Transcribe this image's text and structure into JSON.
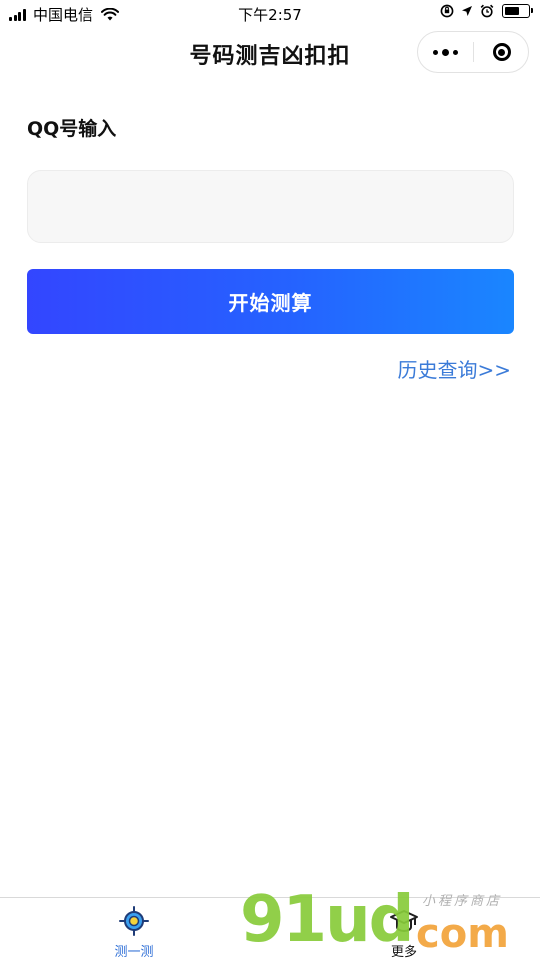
{
  "status_bar": {
    "carrier": "中国电信",
    "time": "下午2:57",
    "icons": [
      "signal-icon",
      "wifi-icon",
      "orientation-lock-icon",
      "location-icon",
      "alarm-icon",
      "battery-icon"
    ]
  },
  "nav": {
    "title": "号码测吉凶扣扣",
    "capsule_icons": [
      "more-dots-icon",
      "close-target-icon"
    ]
  },
  "form": {
    "label": "QQ号输入",
    "input_value": "",
    "button_label": "开始测算",
    "history_link": "历史查询>>"
  },
  "colors": {
    "button_gradient_start": "#3346ff",
    "button_gradient_end": "#1a86ff",
    "link": "#3b7bd8",
    "tab_active": "#2f6fd6"
  },
  "tabbar": {
    "items": [
      {
        "label": "测一测",
        "icon": "target-icon",
        "active": true
      },
      {
        "label": "更多",
        "icon": "graduation-cap-icon",
        "active": false
      }
    ]
  },
  "watermark": {
    "brand": "91ud",
    "suffix": "com",
    "tagline": "小程序商店"
  }
}
